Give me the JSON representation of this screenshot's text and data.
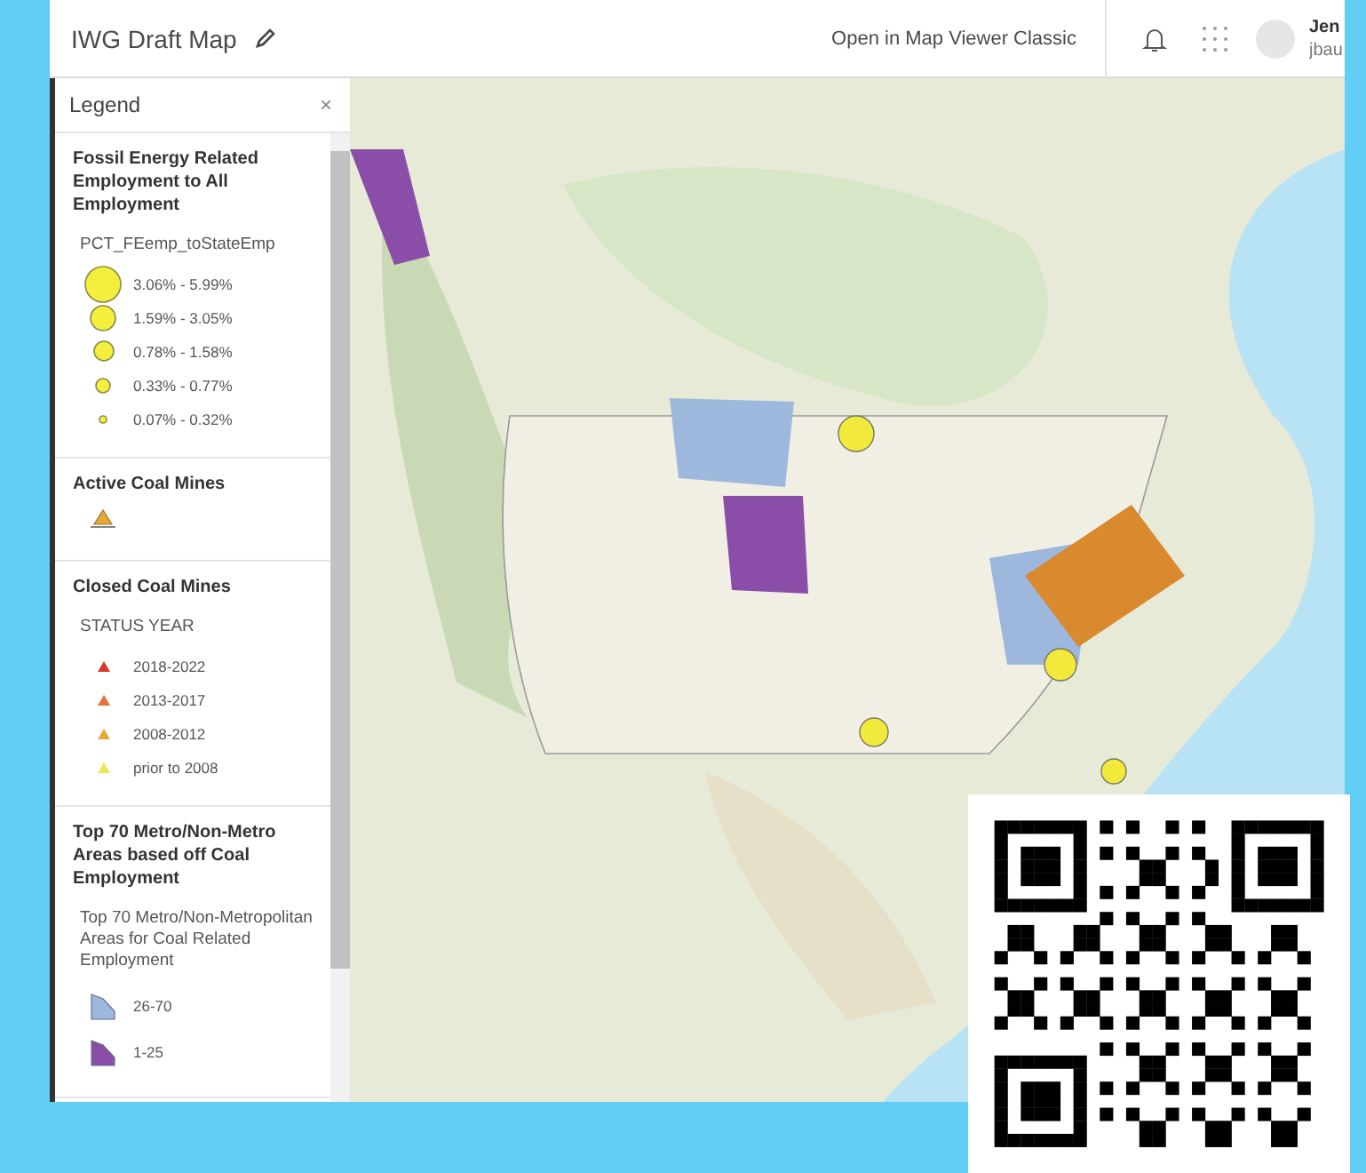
{
  "header": {
    "title": "IWG Draft Map",
    "link": "Open in Map Viewer Classic",
    "user_name": "Jen",
    "user_id": "jbau"
  },
  "legend": {
    "title": "Legend",
    "close": "×",
    "sections": [
      {
        "title": "Fossil Energy Related Employment to All Employment",
        "field": "PCT_FEemp_toStateEmp",
        "items": [
          {
            "kind": "circle",
            "label": "3.06% - 5.99%"
          },
          {
            "kind": "circle",
            "label": "1.59% - 3.05%"
          },
          {
            "kind": "circle",
            "label": "0.78% - 1.58%"
          },
          {
            "kind": "circle",
            "label": "0.33% - 0.77%"
          },
          {
            "kind": "circle",
            "label": "0.07% - 0.32%"
          }
        ]
      },
      {
        "title": "Active Coal Mines",
        "items": [
          {
            "kind": "large-triangle",
            "color": "#e8a838"
          }
        ]
      },
      {
        "title": "Closed Coal Mines",
        "field": "STATUS YEAR",
        "items": [
          {
            "kind": "triangle",
            "color": "#d63a2a",
            "label": "2018-2022"
          },
          {
            "kind": "triangle",
            "color": "#e8703a",
            "label": "2013-2017"
          },
          {
            "kind": "triangle",
            "color": "#e8a838",
            "label": "2008-2012"
          },
          {
            "kind": "triangle",
            "color": "#e8e85a",
            "label": "prior to 2008"
          }
        ]
      },
      {
        "title": "Top 70 Metro/Non-Metro Areas based off Coal Employment",
        "field": "Top 70 Metro/Non-Metropolitan Areas for Coal Related Employment",
        "items": [
          {
            "kind": "polygon",
            "color": "#9db8dc",
            "label": "26-70"
          },
          {
            "kind": "polygon",
            "color": "#8a4ea8",
            "label": "1-25"
          }
        ]
      }
    ]
  }
}
